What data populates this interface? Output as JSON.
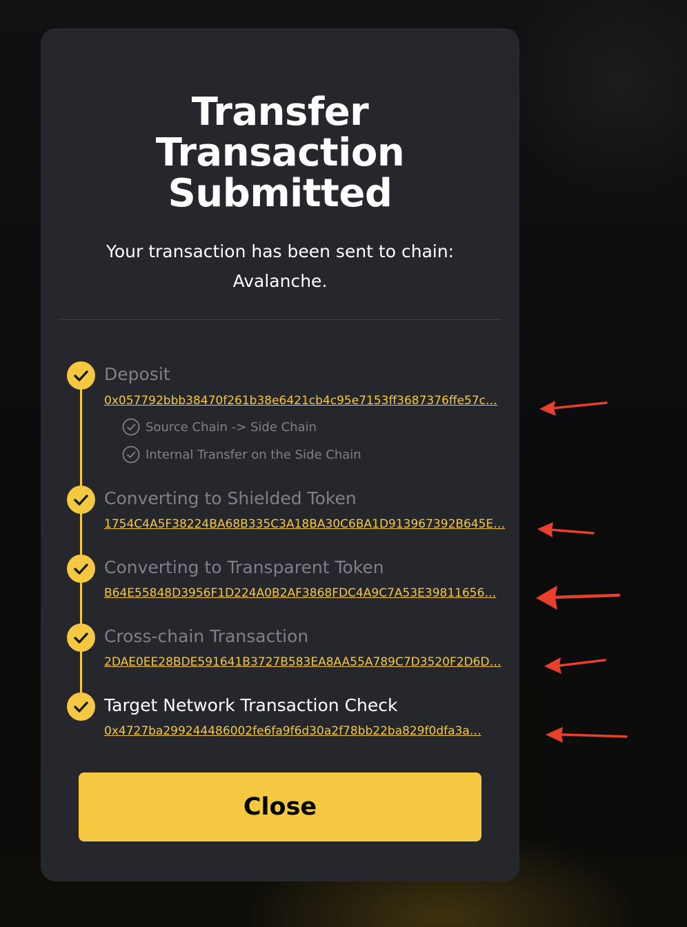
{
  "modal": {
    "title_lines": [
      "Transfer",
      "Transaction",
      "Submitted"
    ],
    "subtitle_lines": [
      "Your transaction has been sent to chain:",
      "Avalanche."
    ],
    "steps": [
      {
        "label": "Deposit",
        "tx_hash": "0x057792bbb38470f261b38e6421cb4c95e7153ff3687376ffe57c…",
        "substeps": [
          "Source Chain -> Side Chain",
          "Internal Transfer on the Side Chain"
        ]
      },
      {
        "label": "Converting to Shielded Token",
        "tx_hash": "1754C4A5F38224BA68B335C3A18BA30C6BA1D913967392B645E…"
      },
      {
        "label": "Converting to Transparent Token",
        "tx_hash": "B64E55848D3956F1D224A0B2AF3868FDC4A9C7A53E39811656…"
      },
      {
        "label": "Cross-chain Transaction",
        "tx_hash": "2DAE0EE28BDE591641B3727B583EA8AA55A789C7D3520F2D6D…"
      },
      {
        "label": "Target Network Transaction Check",
        "tx_hash": "0x4727ba299244486002fe6fa9f6d30a2f78bb22ba829f0dfa3a…"
      }
    ],
    "close_label": "Close"
  },
  "icons": {
    "step_done": "check-icon",
    "substep_done": "check-circle-icon",
    "annotation": "red-arrow-icon"
  },
  "colors": {
    "accent": "#f5c841",
    "panel": "#25272c",
    "muted_text": "#7e8189",
    "annotation": "#e8402c"
  }
}
